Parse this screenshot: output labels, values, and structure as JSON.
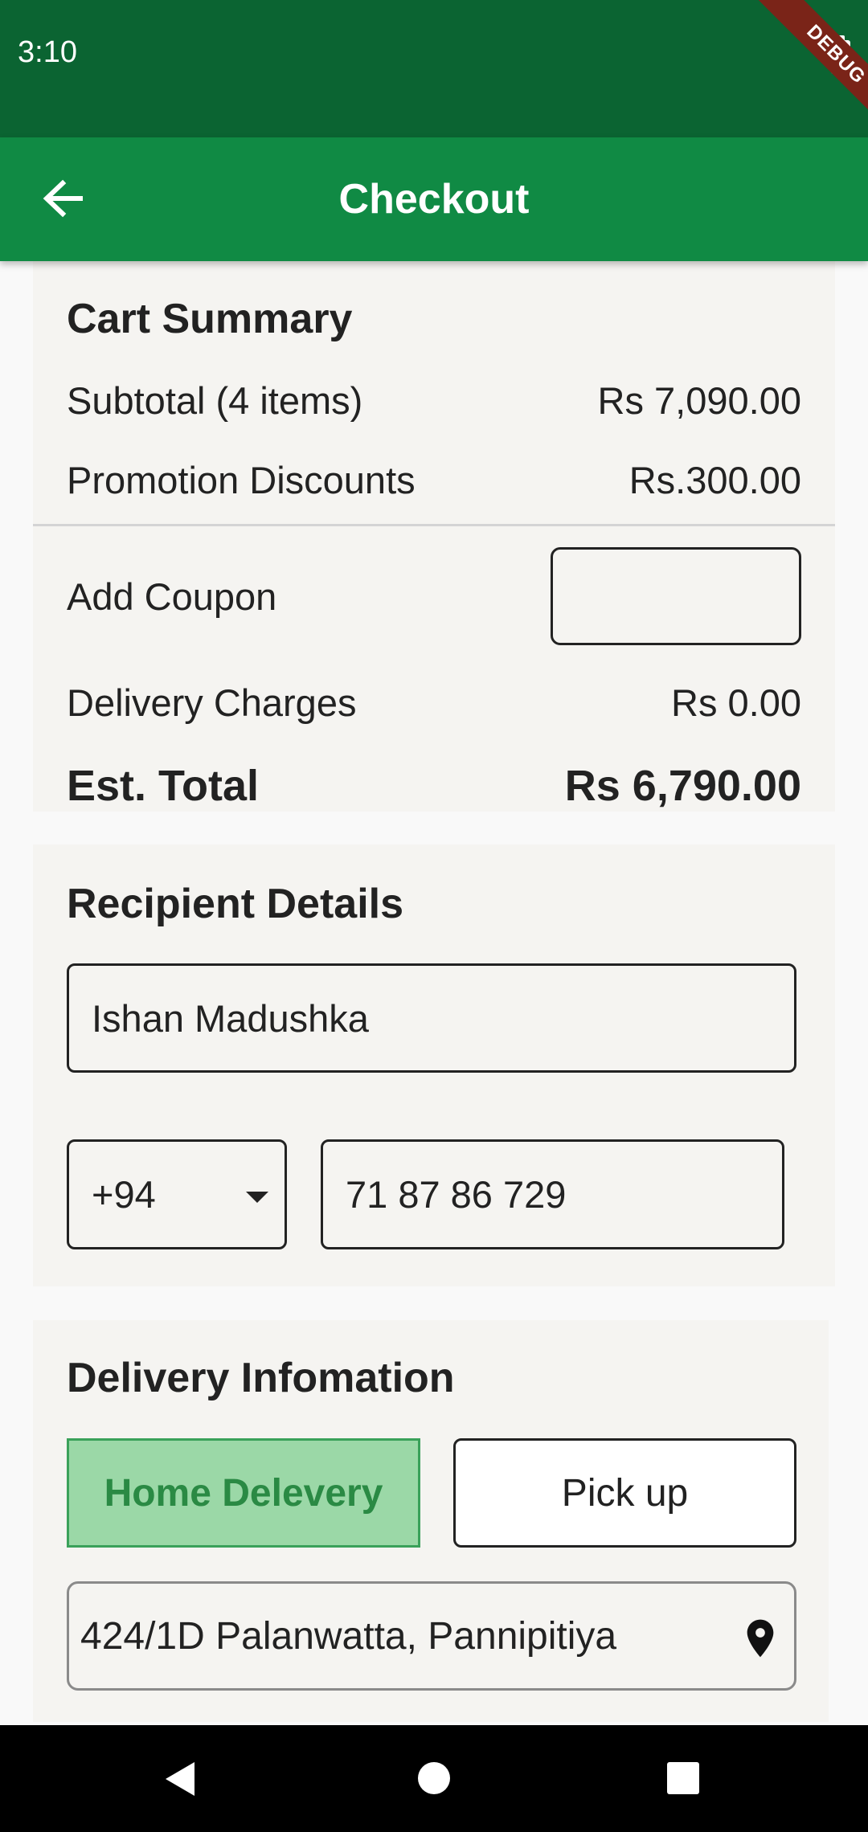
{
  "status_bar": {
    "time": "3:10",
    "debug_label": "DEBUG"
  },
  "app_bar": {
    "title": "Checkout",
    "back_icon": "arrow-left-icon"
  },
  "cart_summary": {
    "title": "Cart Summary",
    "subtotal_label": "Subtotal (4 items)",
    "subtotal_value": "Rs 7,090.00",
    "promotion_label": "Promotion Discounts",
    "promotion_value": "Rs.300.00",
    "coupon_label": "Add Coupon",
    "coupon_value": "",
    "delivery_label": "Delivery Charges",
    "delivery_value": "Rs 0.00",
    "total_label": "Est. Total",
    "total_value": "Rs 6,790.00"
  },
  "recipient": {
    "title": "Recipient Details",
    "name_value": "Ishan Madushka",
    "country_code": "+94",
    "phone_value": "71 87 86 729"
  },
  "delivery": {
    "title": "Delivery Infomation",
    "home_delivery_label": "Home Delevery",
    "pickup_label": "Pick up",
    "selected_option": "Home Delevery",
    "address_value": "424/1D Palanwatta, Pannipitiya",
    "address_icon": "location-pin-icon"
  },
  "colors": {
    "status_bar": "#0b6432",
    "app_bar": "#108a44",
    "selected_toggle_bg": "#9bd8a7",
    "selected_toggle_text": "#2a8a44"
  }
}
